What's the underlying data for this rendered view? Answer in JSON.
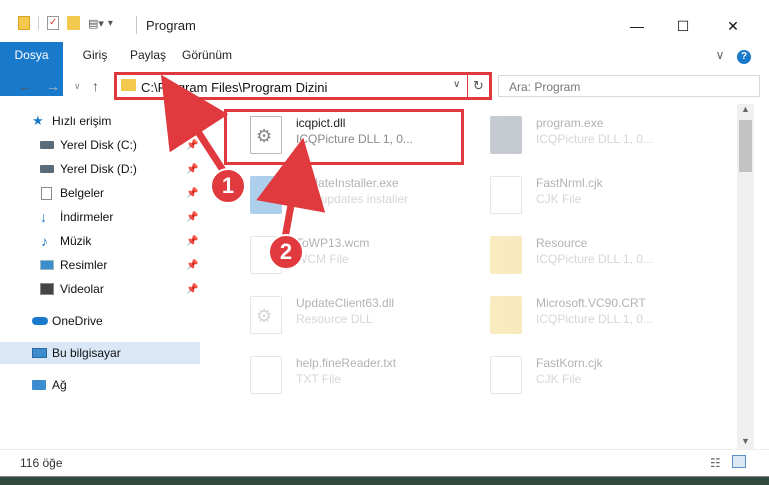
{
  "window": {
    "title": "Program",
    "minimize": "—",
    "maximize": "☐",
    "close": "✕"
  },
  "ribbon": {
    "tabs": [
      "Dosya",
      "Giriş",
      "Paylaş",
      "Görünüm"
    ],
    "expand": "∨",
    "help": "?"
  },
  "address": {
    "path": "C:\\Program Files\\Program Dizini",
    "search_placeholder": "Ara: Program"
  },
  "sidebar": {
    "items": [
      {
        "label": "Hızlı erişim",
        "icon": "star-icon",
        "color": "#1979ca"
      },
      {
        "label": "Yerel Disk (C:)",
        "icon": "drive-icon",
        "color": "#5a6b7a",
        "pinned": true
      },
      {
        "label": "Yerel Disk (D:)",
        "icon": "drive-icon",
        "color": "#5a6b7a",
        "pinned": true
      },
      {
        "label": "Belgeler",
        "icon": "documents-icon",
        "color": "#8a8a8a",
        "pinned": true
      },
      {
        "label": "İndirmeler",
        "icon": "download-icon",
        "color": "#1979ca",
        "pinned": true
      },
      {
        "label": "Müzik",
        "icon": "music-icon",
        "color": "#1979ca",
        "pinned": true
      },
      {
        "label": "Resimler",
        "icon": "pictures-icon",
        "color": "#3c8dcf",
        "pinned": true
      },
      {
        "label": "Videolar",
        "icon": "videos-icon",
        "color": "#444444",
        "pinned": true
      },
      {
        "label": "OneDrive",
        "icon": "cloud-icon",
        "color": "#1979ca"
      },
      {
        "label": "Bu bilgisayar",
        "icon": "computer-icon",
        "color": "#3c8dcf",
        "selected": true
      },
      {
        "label": "Ağ",
        "icon": "network-icon",
        "color": "#3c8dcf"
      }
    ]
  },
  "files": [
    {
      "name": "icqpict.dll",
      "desc": "ICQPicture DLL 1, 0...",
      "icon": "dll-gear-icon",
      "highlight": true
    },
    {
      "name": "program.exe",
      "desc": "ICQPicture DLL 1, 0...",
      "icon": "exe-icon"
    },
    {
      "name": "UpdateInstaller.exe",
      "desc": "ICQ updates installer",
      "icon": "exe-icon"
    },
    {
      "name": "FastNrml.cjk",
      "desc": "CJK File",
      "icon": "file-icon"
    },
    {
      "name": "ToWP13.wcm",
      "desc": "WCM File",
      "icon": "file-icon"
    },
    {
      "name": "Resource",
      "desc": "ICQPicture DLL 1, 0...",
      "icon": "zip-folder-icon"
    },
    {
      "name": "UpdateClient63.dll",
      "desc": "Resource DLL",
      "icon": "dll-gear-icon"
    },
    {
      "name": "Microsoft.VC90.CRT",
      "desc": "ICQPicture DLL 1, 0...",
      "icon": "zip-folder-icon"
    },
    {
      "name": "help.fineReader.txt",
      "desc": "TXT File",
      "icon": "file-icon"
    },
    {
      "name": "FastKorn.cjk",
      "desc": "CJK File",
      "icon": "file-icon"
    }
  ],
  "status": {
    "count": "116 öğe"
  },
  "annotations": {
    "badge1": "1",
    "badge2": "2",
    "color": "#e0393e"
  }
}
